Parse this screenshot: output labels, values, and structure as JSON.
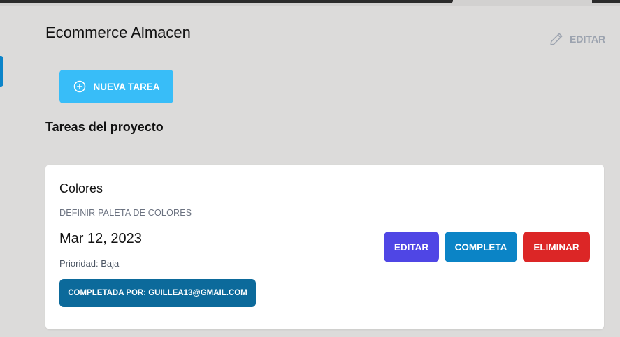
{
  "project": {
    "title": "Ecommerce Almacen",
    "edit_label": "EDITAR"
  },
  "toolbar": {
    "new_task_label": "NUEVA TAREA"
  },
  "tasks_section": {
    "title": "Tareas del proyecto"
  },
  "task": {
    "name": "Colores",
    "description": "DEFINIR PALETA DE COLORES",
    "date": "Mar 12, 2023",
    "priority": "Prioridad: Baja",
    "completed_by": "COMPLETADA POR: GUILLEA13@GMAIL.COM",
    "actions": {
      "edit": "EDITAR",
      "complete": "COMPLETA",
      "delete": "ELIMINAR"
    }
  },
  "colors": {
    "background": "#dcdbda",
    "new_task": "#38bdf8",
    "edit": "#4f46e5",
    "complete": "#0b84c6",
    "delete": "#dc2626",
    "completed_badge": "#0c6a9b"
  },
  "icons": {
    "edit_project": "pencil-icon",
    "new_task": "plus-circle-icon"
  }
}
